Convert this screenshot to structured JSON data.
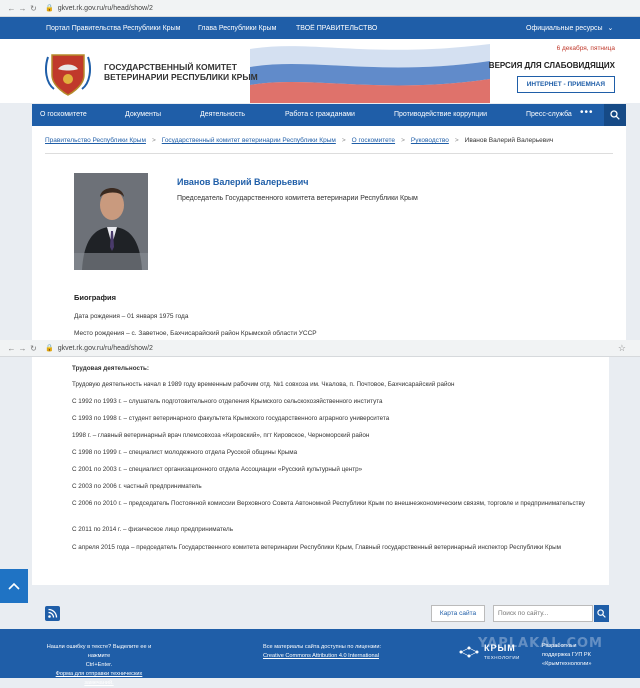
{
  "browser_top": {
    "url": "gkvet.rk.gov.ru/ru/head/show/2"
  },
  "browser_bottom": {
    "url": "gkvet.rk.gov.ru/ru/head/show/2"
  },
  "topbar": {
    "links": [
      "Портал Правительства Республики Крым",
      "Глава Республики Крым",
      "ТВОЁ ПРАВИТЕЛЬСТВО"
    ],
    "resources": "Официальные ресурсы",
    "resources_arrow": "⌄"
  },
  "header": {
    "org_line1": "ГОСУДАРСТВЕННЫЙ КОМИТЕТ",
    "org_line2": "ВЕТЕРИНАРИИ РЕСПУБЛИКИ КРЫМ",
    "date": "6 декабря, пятница",
    "weak_sight": "ВЕРСИЯ ДЛЯ СЛАБОВИДЯЩИХ",
    "reception": "ИНТЕРНЕТ - ПРИЕМНАЯ",
    "colors": {
      "blue": "#1f5ea8",
      "red": "#c0392b"
    }
  },
  "nav": {
    "items": [
      "О госкомитете",
      "Документы",
      "Деятельность",
      "Работа с гражданами",
      "Противодействие коррупции",
      "Пресс-служба"
    ],
    "more": "•••"
  },
  "breadcrumb": {
    "items": [
      "Правительство Республики Крым",
      "Государственный комитет ветеринарии Республики Крым",
      "О госкомитете",
      "Руководство"
    ],
    "separator": ">",
    "current": "Иванов Валерий Валерьевич"
  },
  "person": {
    "name": "Иванов Валерий Валерьевич",
    "position": "Председатель Государственного комитета ветеринарии Республики Крым"
  },
  "bio": {
    "title": "Биография",
    "birth_date": "Дата рождения – 01 января 1975 года",
    "birth_place": "Место рождения – с. Заветное, Бахчисарайский район Крымской области УССР"
  },
  "career": {
    "title": "Трудовая деятельность:",
    "entries": [
      "Трудовую деятельность начал в 1989 году временным рабочим отд. №1 совхоза им. Чкалова, п. Почтовое, Бахчисарайский район",
      "С 1992 по 1993 г. – слушатель подготовительного отделения Крымского сельскохозяйственного института",
      "С 1993 по 1998 г. – студент ветеринарного факультета Крымского государственного аграрного университета",
      "1998 г. – главный ветеринарный врач племсовхоза «Кировский», пгт Кировское, Черноморский район",
      "С 1998 по 1999 г. – специалист молодежного отдела Русской общины Крыма",
      "С 2001 по 2003 г. – специалист организационного отдела Ассоциации «Русский культурный центр»",
      "С 2003 по 2006 г. частный предприниматель",
      "С 2006 по 2010 г. – председатель Постоянной комиссии Верховного Совета Автономной Республики Крым по внешнеэкономическим связям, торговле и предпринимательству",
      "С 2011 по 2014 г. – физическое лицо предприниматель",
      "С апреля 2015 года – председатель Государственного комитета ветеринарии Республики Крым, Главный государственный ветеринарный инспектор Республики Крым"
    ]
  },
  "tools": {
    "sitemap": "Карта сайта",
    "search_placeholder": "Поиск по сайту..."
  },
  "footer": {
    "error_line1": "Нашли ошибку в тексте? Выделите ее и нажмите",
    "error_line2": "Ctrl+Enter.",
    "form_link": "Форма для отправки технических замечаний.",
    "license_line1": "Все материалы сайта доступны по лицензии:",
    "license_link": "Creative Commons Attribution 4.0 International",
    "tech_brand": "КРЫМ",
    "tech_sub": "ТЕХНОЛОГИИ",
    "dev_line1": "Разработка и",
    "dev_line2": "поддержка ГУП РК",
    "dev_line3": "«Крымтехнологии»",
    "watermark": "YAPLAKAL.COM"
  }
}
